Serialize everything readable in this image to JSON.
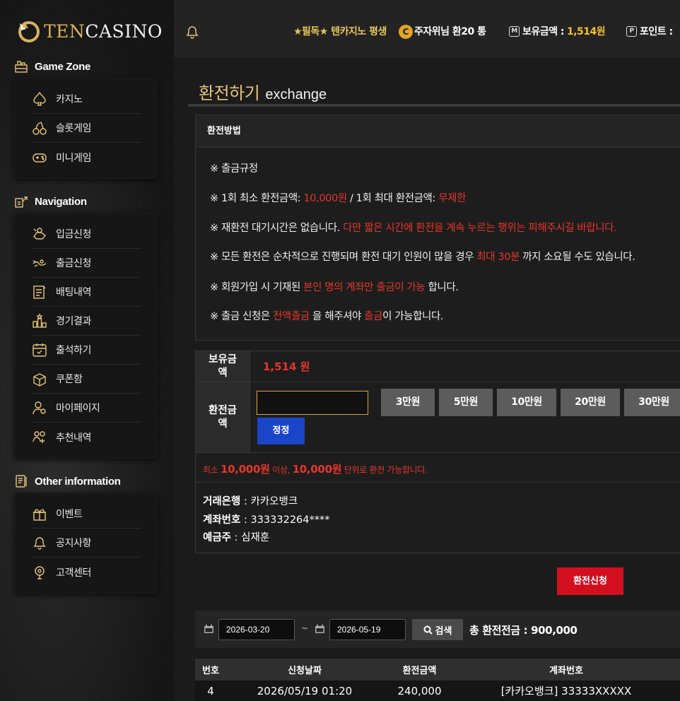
{
  "logo": {
    "text_a": "TEN",
    "text_b": "CASINO"
  },
  "topbar": {
    "marquee": "★필독★ 텐카지노 평생",
    "overlap_badge": "C",
    "overlap_text": "주자위님 환20 통",
    "balance_label": "보유금액 :",
    "balance_value": "1,514원",
    "balance_icon": "M",
    "points_label": "포인트 :",
    "points_icon": "P"
  },
  "sidebar": {
    "sections": [
      {
        "title": "Game Zone",
        "icon": "game-zone-icon",
        "items": [
          {
            "label": "카지노",
            "icon": "spade-icon"
          },
          {
            "label": "슬롯게임",
            "icon": "cherry-icon"
          },
          {
            "label": "미니게임",
            "icon": "gamepad-icon"
          }
        ]
      },
      {
        "title": "Navigation",
        "icon": "navigation-icon",
        "items": [
          {
            "label": "입금신청",
            "icon": "deposit-icon"
          },
          {
            "label": "출금신청",
            "icon": "withdraw-icon"
          },
          {
            "label": "배팅내역",
            "icon": "betting-history-icon"
          },
          {
            "label": "경기결과",
            "icon": "results-icon"
          },
          {
            "label": "출석하기",
            "icon": "attendance-icon"
          },
          {
            "label": "쿠폰함",
            "icon": "coupon-icon"
          },
          {
            "label": "마이페이지",
            "icon": "mypage-icon"
          },
          {
            "label": "추천내역",
            "icon": "referral-icon"
          }
        ]
      },
      {
        "title": "Other information",
        "icon": "other-info-icon",
        "items": [
          {
            "label": "이벤트",
            "icon": "gift-icon"
          },
          {
            "label": "공지사항",
            "icon": "bell-icon"
          },
          {
            "label": "고객센터",
            "icon": "support-icon"
          }
        ]
      }
    ]
  },
  "page": {
    "title_ko": "환전하기",
    "title_en": "exchange"
  },
  "rules": {
    "header": "환전방법",
    "title": "※ 출금규정",
    "l1_a": "※ 1회 최소 환전금액: ",
    "l1_b": "10,000원",
    "l1_c": " / 1회 최대 환전금액: ",
    "l1_d": "무제한",
    "l2_a": "※ 재환전 대기시간은 없습니다. ",
    "l2_b": "다만 짧은 시간에 환전을 계속 누르는 행위는 피해주시길 바랍니다.",
    "l3_a": "※ 모든 환전은 순차적으로 진행되며 환전 대기 인원이 많을 경우 ",
    "l3_b": "최대 30분",
    "l3_c": " 까지 소요될 수도 있습니다.",
    "l4_a": "※ 회원가입 시 기재된 ",
    "l4_b": "본인 명의 계좌만 출금이 가능",
    "l4_c": " 합니다.",
    "l5_a": "※ 출금 신청은 ",
    "l5_b": "전액출금",
    "l5_c": " 을 해주셔야 ",
    "l5_d": "출금",
    "l5_e": "이 가능합니다."
  },
  "form": {
    "balance_label_1": "보유금",
    "balance_label_2": "액",
    "balance_value": "1,514 원",
    "amount_label_1": "환전금",
    "amount_label_2": "액",
    "amount_value": "",
    "chips": [
      "3만원",
      "5만원",
      "10만원",
      "20만원",
      "30만원"
    ],
    "fix_button": "정정",
    "min_a": "최소 ",
    "min_b": "10,000원",
    "min_c": " 이상, ",
    "min_d": "10,000원",
    "min_e": "  단위로 환전 가능합니다.",
    "bank_label": "거래은행",
    "bank_value": " : 카카오뱅크",
    "account_label": "계좌번호",
    "account_value": " : 333332264****",
    "holder_label": "예금주",
    "holder_value": " : 심재훈",
    "apply_button": "환전신청"
  },
  "search": {
    "date_from": "2026-03-20",
    "date_to": "2026-05-19",
    "tilde": "~",
    "button": "검색",
    "total_label": "총 환전전금 : ",
    "total_value": "900,000"
  },
  "table": {
    "headers": [
      "번호",
      "신청날짜",
      "환전금액",
      "계좌번호"
    ],
    "rows": [
      {
        "no": "4",
        "date": "2026/05/19 01:20",
        "amount": "240,000",
        "account": "[카카오뱅크] 33333XXXXX"
      }
    ]
  },
  "colors": {
    "gold": "#e6c37a",
    "red": "#e8352a",
    "apply": "#d30f1f",
    "fix": "#1b45c8"
  }
}
